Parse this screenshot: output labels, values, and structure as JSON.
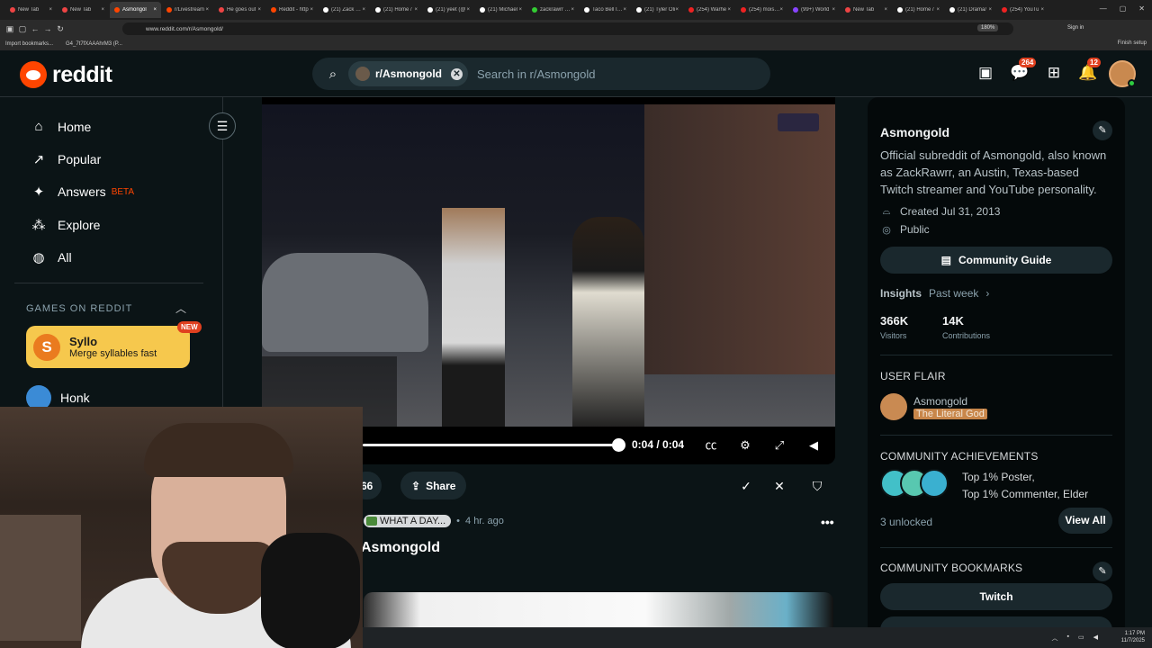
{
  "browser": {
    "tabs": [
      {
        "label": "New Tab",
        "color": "#e44"
      },
      {
        "label": "New Tab",
        "color": "#e44"
      },
      {
        "label": "Asmongol",
        "color": "#ff4500",
        "active": true
      },
      {
        "label": "r/Livestream",
        "color": "#ff4500"
      },
      {
        "label": "He goes out",
        "color": "#e44"
      },
      {
        "label": "Reddit - http",
        "color": "#ff4500"
      },
      {
        "label": "(21) Zack (@",
        "color": "#fff"
      },
      {
        "label": "(21) Home /",
        "color": "#fff"
      },
      {
        "label": "(21) yeet (@",
        "color": "#fff"
      },
      {
        "label": "(21) Michael",
        "color": "#fff"
      },
      {
        "label": "zackrawrr - S",
        "color": "#3c3"
      },
      {
        "label": "Taco Bell Is F",
        "color": "#fff"
      },
      {
        "label": "(21) Tyler Oli",
        "color": "#fff"
      },
      {
        "label": "(254) Warhe",
        "color": "#e22"
      },
      {
        "label": "(254) moist c",
        "color": "#e22"
      },
      {
        "label": "(99+) World",
        "color": "#84f"
      },
      {
        "label": "New Tab",
        "color": "#e44"
      },
      {
        "label": "(21) Home /",
        "color": "#fff"
      },
      {
        "label": "(21) Drama/",
        "color": "#fff"
      },
      {
        "label": "(254) YouTu",
        "color": "#e22"
      }
    ],
    "url": "www.reddit.com/r/Asmongold/",
    "zoom": "180%",
    "signin": "Sign in",
    "bookmarks": [
      "Import bookmarks...",
      "G4_7t7fXAAAhrM3 (P..."
    ],
    "finish_setup": "Finish setup"
  },
  "header": {
    "logo_text": "reddit",
    "search_chip": "r/Asmongold",
    "search_placeholder": "Search in r/Asmongold",
    "chat_badge": "264",
    "notif_badge": "12"
  },
  "sidebar": {
    "items": [
      {
        "label": "Home",
        "icon": "⌂"
      },
      {
        "label": "Popular",
        "icon": "↗"
      },
      {
        "label": "Answers",
        "icon": "✦",
        "badge": "BETA"
      },
      {
        "label": "Explore",
        "icon": "⁂"
      },
      {
        "label": "All",
        "icon": "◍"
      }
    ],
    "games_header": "GAMES ON REDDIT",
    "syllo_icon": "S",
    "syllo_title": "Syllo",
    "syllo_sub": "Merge syllables fast",
    "new_badge": "NEW",
    "honk": "Honk"
  },
  "video": {
    "time": "0:04 / 0:04",
    "progress": 1.0
  },
  "actions": {
    "count": "66",
    "share": "Share"
  },
  "post": {
    "flair": "WHAT A DAY...",
    "age": "4 hr. ago",
    "title": "Asmongold"
  },
  "rightpanel": {
    "title": "Asmongold",
    "description": "Official subreddit of Asmongold, also known as ZackRawrr, an Austin, Texas-based Twitch streamer and YouTube personality.",
    "created": "Created Jul 31, 2013",
    "visibility": "Public",
    "community_guide": "Community Guide",
    "insights": "Insights",
    "period": "Past week",
    "visitors_n": "366K",
    "visitors_l": "Visitors",
    "contrib_n": "14K",
    "contrib_l": "Contributions",
    "user_flair_h": "USER FLAIR",
    "user_name": "Asmongold",
    "user_tag": "The Literal God",
    "ach_h": "COMMUNITY ACHIEVEMENTS",
    "ach_1": "Top 1% Poster,",
    "ach_2": "Top 1% Commenter, Elder",
    "unlocked": "3 unlocked",
    "view_all": "View All",
    "bookmarks_h": "COMMUNITY BOOKMARKS",
    "twitch": "Twitch"
  },
  "taskbar": {
    "time": "1:17 PM",
    "date": "11/7/2025"
  },
  "colors": {
    "accent": "#ff4500",
    "bg": "#0b1416"
  }
}
